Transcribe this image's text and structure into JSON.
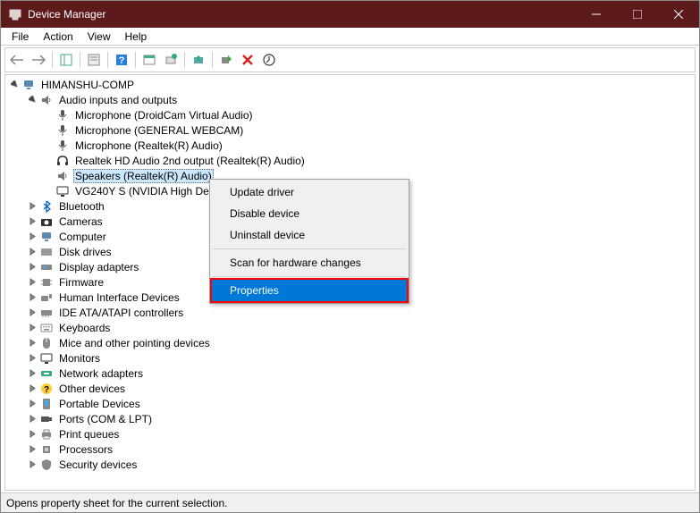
{
  "window": {
    "title": "Device Manager"
  },
  "menu": {
    "file": "File",
    "action": "Action",
    "view": "View",
    "help": "Help"
  },
  "root": "HIMANSHU-COMP",
  "audio": {
    "label": "Audio inputs and outputs",
    "items": [
      "Microphone (DroidCam Virtual Audio)",
      "Microphone (GENERAL WEBCAM)",
      "Microphone (Realtek(R) Audio)",
      "Realtek HD Audio 2nd output (Realtek(R) Audio)",
      "Speakers (Realtek(R) Audio)",
      "VG240Y S (NVIDIA High Definition Audio)"
    ]
  },
  "cats": {
    "bluetooth": "Bluetooth",
    "cameras": "Cameras",
    "computer": "Computer",
    "disk": "Disk drives",
    "display": "Display adapters",
    "firmware": "Firmware",
    "hid": "Human Interface Devices",
    "ide": "IDE ATA/ATAPI controllers",
    "keyboards": "Keyboards",
    "mice": "Mice and other pointing devices",
    "monitors": "Monitors",
    "network": "Network adapters",
    "other": "Other devices",
    "portable": "Portable Devices",
    "ports": "Ports (COM & LPT)",
    "printq": "Print queues",
    "processors": "Processors",
    "security": "Security devices"
  },
  "ctx": {
    "update": "Update driver",
    "disable": "Disable device",
    "uninstall": "Uninstall device",
    "scan": "Scan for hardware changes",
    "properties": "Properties"
  },
  "status": "Opens property sheet for the current selection."
}
